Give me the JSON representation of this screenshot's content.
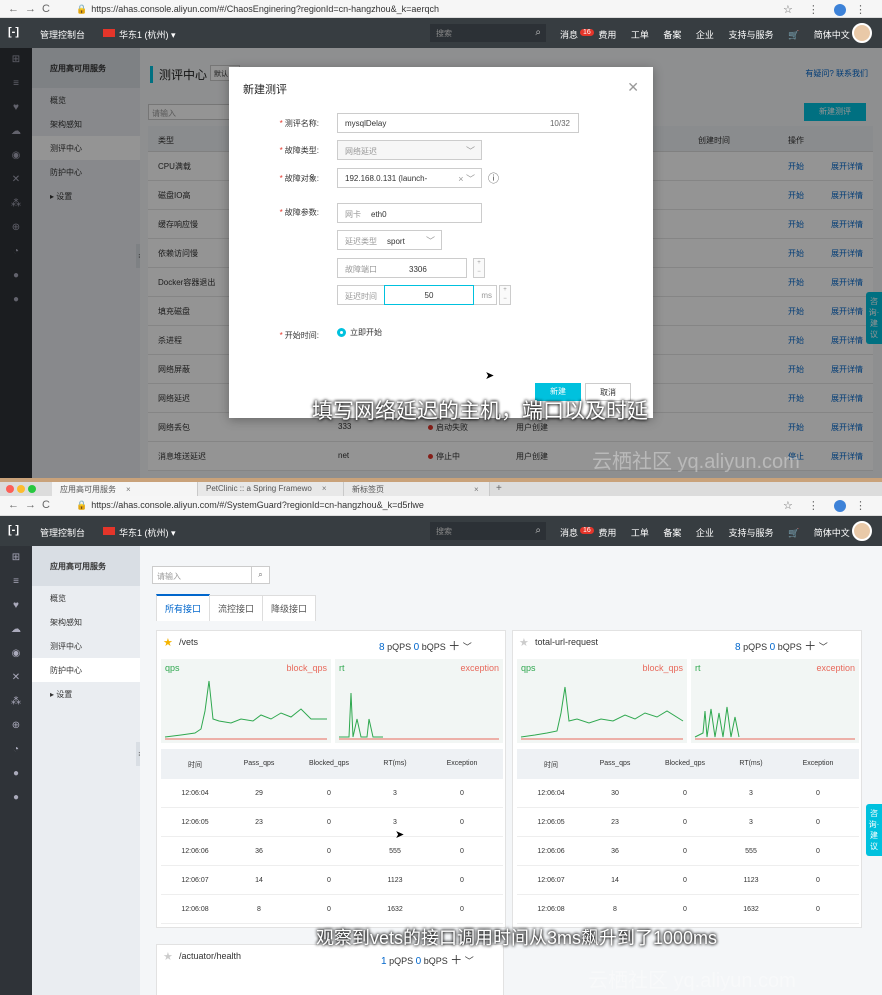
{
  "browser": {
    "tabs": [
      {
        "label": "应用高可用服务"
      },
      {
        "label": "PetClinic :: a Spring Framewo"
      },
      {
        "label": "新标签页"
      }
    ],
    "url1": "https://ahas.console.aliyun.com/#/ChaosEnginering?regionId=cn-hangzhou&_k=aerqch",
    "url2": "https://ahas.console.aliyun.com/#/SystemGuard?regionId=cn-hangzhou&_k=d5rlwe"
  },
  "topbar": {
    "logo": "[-]",
    "console": "管理控制台",
    "region": "华东1 (杭州) ▾",
    "search_placeholder": "搜索",
    "messages": "消息",
    "messages_badge": "16",
    "menu": [
      "费用",
      "工单",
      "备案",
      "企业",
      "支持与服务"
    ],
    "language": "简体中文"
  },
  "sidenav": {
    "title": "应用高可用服务",
    "items": [
      "概览",
      "架构感知",
      "测评中心",
      "防护中心",
      "▸ 设置"
    ]
  },
  "page1": {
    "title": "测评中心",
    "title_select": "默认",
    "help": "有疑问? 联系我们",
    "search_placeholder": "请输入",
    "new_button": "新建测评",
    "headers": {
      "type": "类型",
      "created_time": "创建时间",
      "ops": "操作"
    },
    "rows": [
      {
        "type": "CPU满载",
        "op1": "开始",
        "op2": "展开详情"
      },
      {
        "type": "磁盘IO高",
        "op1": "开始",
        "op2": "展开详情"
      },
      {
        "type": "缓存响应慢",
        "op1": "开始",
        "op2": "展开详情"
      },
      {
        "type": "依赖访问慢",
        "op1": "开始",
        "op2": "展开详情"
      },
      {
        "type": "Docker容器退出",
        "op1": "开始",
        "op2": "展开详情"
      },
      {
        "type": "填充磁盘",
        "op1": "开始",
        "op2": "展开详情"
      },
      {
        "type": "杀进程",
        "op1": "开始",
        "op2": "展开详情"
      },
      {
        "type": "网络屏蔽",
        "op1": "开始",
        "op2": "展开详情"
      },
      {
        "type": "网络延迟",
        "op1": "开始",
        "op2": "展开详情"
      },
      {
        "type": "网络丢包",
        "col2": "333",
        "status": "启动失败",
        "creator": "用户创建",
        "op1": "开始",
        "op2": "展开详情"
      },
      {
        "type": "消息堆送延迟",
        "col2": "net",
        "status": "停止中",
        "creator": "用户创建",
        "op1": "停止",
        "op2": "展开详情"
      }
    ]
  },
  "modal": {
    "title": "新建测评",
    "name_label": "测评名称:",
    "name_value": "mysqlDelay",
    "name_count": "10/32",
    "fault_type_label": "故障类型:",
    "fault_type_value": "网络延迟",
    "target_label": "故障对象:",
    "target_value": "192.168.0.131 (launch-",
    "params_label": "故障参数:",
    "nic_label": "网卡",
    "nic_value": "eth0",
    "delay_type_label": "延迟类型",
    "delay_type_value": "sport",
    "port_label": "故障端口",
    "port_value": "3306",
    "delay_time_label": "延迟时间",
    "delay_time_value": "50",
    "delay_unit": "ms",
    "start_label": "开始时间:",
    "start_option": "立即开始",
    "ok_button": "新建",
    "cancel_button": "取消"
  },
  "subtitle1": "填写网络延迟的主机，端口以及时延",
  "watermark1": "云栖社区 yq.aliyun.com",
  "page2": {
    "search_placeholder": "请输入",
    "tabs": [
      "所有接口",
      "流控接口",
      "降级接口"
    ],
    "cards": [
      {
        "name": "/vets",
        "pqps": "8",
        "pqps_unit": "pQPS",
        "bqps": "0",
        "bqps_unit": "bQPS",
        "left_label": "qps",
        "left_label2": "block_qps",
        "right_label": "rt",
        "right_label2": "exception",
        "columns": [
          "时间",
          "Pass_qps",
          "Blocked_qps",
          "RT(ms)",
          "Exception"
        ],
        "rows": [
          [
            "12:06:04",
            "29",
            "0",
            "3",
            "0"
          ],
          [
            "12:06:05",
            "23",
            "0",
            "3",
            "0"
          ],
          [
            "12:06:06",
            "36",
            "0",
            "555",
            "0"
          ],
          [
            "12:06:07",
            "14",
            "0",
            "1123",
            "0"
          ],
          [
            "12:06:08",
            "8",
            "0",
            "1632",
            "0"
          ]
        ]
      },
      {
        "name": "total-url-request",
        "pqps": "8",
        "pqps_unit": "pQPS",
        "bqps": "0",
        "bqps_unit": "bQPS",
        "left_label": "qps",
        "left_label2": "block_qps",
        "right_label": "rt",
        "right_label2": "exception",
        "columns": [
          "时间",
          "Pass_qps",
          "Blocked_qps",
          "RT(ms)",
          "Exception"
        ],
        "rows": [
          [
            "12:06:04",
            "30",
            "0",
            "3",
            "0"
          ],
          [
            "12:06:05",
            "23",
            "0",
            "3",
            "0"
          ],
          [
            "12:06:06",
            "36",
            "0",
            "555",
            "0"
          ],
          [
            "12:06:07",
            "14",
            "0",
            "1123",
            "0"
          ],
          [
            "12:06:08",
            "8",
            "0",
            "1632",
            "0"
          ]
        ]
      }
    ],
    "card3": {
      "name": "/actuator/health",
      "pqps": "1",
      "pqps_unit": "pQPS",
      "bqps": "0",
      "bqps_unit": "bQPS"
    }
  },
  "feedback": "咨询·建议",
  "subtitle2": "观察到vets的接口调用时间从3ms飙升到了1000ms",
  "watermark2": "云栖社区 yq.aliyun.com",
  "colors": {
    "accent": "#00c1de",
    "link": "#0066cc",
    "topbar": "#373d41",
    "qps_green": "#2fa84f",
    "exception_red": "#e86a5c"
  }
}
